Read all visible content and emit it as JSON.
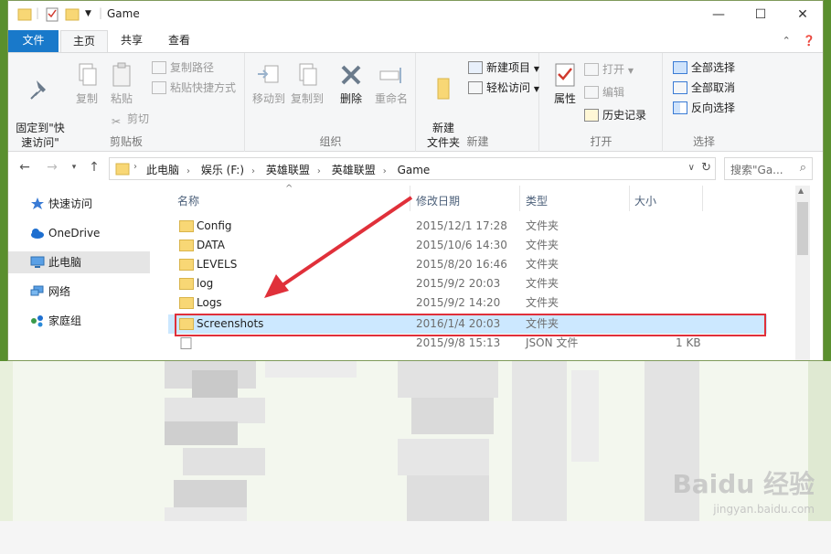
{
  "window": {
    "title": "Game",
    "controls": {
      "minimize": "—",
      "maximize": "☐",
      "close": "✕"
    }
  },
  "tabs": [
    {
      "label": "文件"
    },
    {
      "label": "主页"
    },
    {
      "label": "共享"
    },
    {
      "label": "查看"
    }
  ],
  "ribbon": {
    "clipboard": {
      "group_label": "剪贴板",
      "pin_label": "固定到\"快\n速访问\"",
      "copy_label": "复制",
      "paste_label": "粘贴",
      "copy_path": "复制路径",
      "paste_shortcut": "粘贴快捷方式",
      "cut": "剪切"
    },
    "organize": {
      "group_label": "组织",
      "move_to": "移动到",
      "copy_to": "复制到",
      "delete": "删除",
      "rename": "重命名"
    },
    "new": {
      "group_label": "新建",
      "new_folder": "新建\n文件夹",
      "new_item": "新建项目",
      "easy_access": "轻松访问"
    },
    "open": {
      "group_label": "打开",
      "properties": "属性",
      "open": "打开",
      "edit": "编辑",
      "history": "历史记录"
    },
    "select": {
      "group_label": "选择",
      "select_all": "全部选择",
      "select_none": "全部取消",
      "invert": "反向选择"
    }
  },
  "address": {
    "crumbs": [
      "此电脑",
      "娱乐 (F:)",
      "英雄联盟",
      "英雄联盟",
      "Game"
    ],
    "search_placeholder": "搜索\"Ga..."
  },
  "nav_pane": [
    {
      "label": "快速访问"
    },
    {
      "label": "OneDrive"
    },
    {
      "label": "此电脑"
    },
    {
      "label": "网络"
    },
    {
      "label": "家庭组"
    }
  ],
  "columns": {
    "name": "名称",
    "date": "修改日期",
    "type": "类型",
    "size": "大小"
  },
  "files": [
    {
      "name": "Config",
      "date": "2015/12/1 17:28",
      "type": "文件夹",
      "size": ""
    },
    {
      "name": "DATA",
      "date": "2015/10/6 14:30",
      "type": "文件夹",
      "size": ""
    },
    {
      "name": "LEVELS",
      "date": "2015/8/20 16:46",
      "type": "文件夹",
      "size": ""
    },
    {
      "name": "log",
      "date": "2015/9/2 20:03",
      "type": "文件夹",
      "size": ""
    },
    {
      "name": "Logs",
      "date": "2015/9/2 14:20",
      "type": "文件夹",
      "size": ""
    },
    {
      "name": "Screenshots",
      "date": "2016/1/4 20:03",
      "type": "文件夹",
      "size": ""
    },
    {
      "name": "",
      "date": "2015/9/8 15:13",
      "type": "JSON 文件",
      "size": "1 KB"
    }
  ],
  "watermark": {
    "main": "Baidu 经验",
    "sub": "jingyan.baidu.com"
  },
  "colors": {
    "accent": "#1979ca",
    "highlight_border": "#e0303a",
    "selected_row": "#cce8ff"
  }
}
